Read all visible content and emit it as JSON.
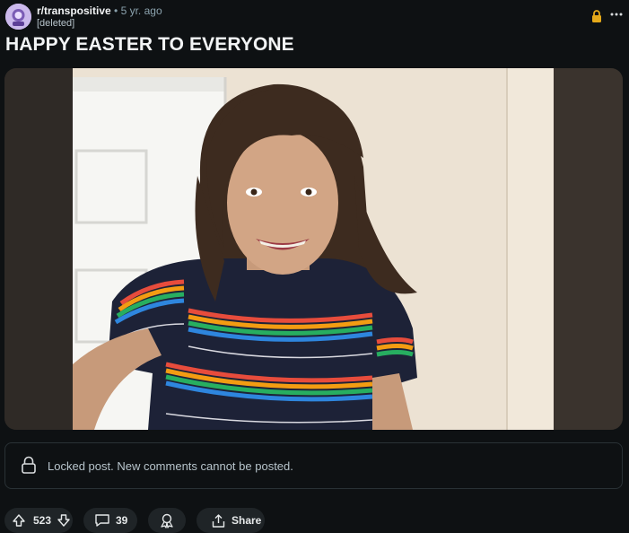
{
  "post": {
    "subreddit": "r/transpositive",
    "separator": "•",
    "age": "5 yr. ago",
    "author": "[deleted]",
    "title": "HAPPY EASTER TO EVERYONE"
  },
  "locked_notice": "Locked post. New comments cannot be posted.",
  "actions": {
    "votes": "523",
    "comments": "39",
    "share_label": "Share"
  },
  "icons": {
    "lock_top": "lock-icon",
    "more": "ellipsis-icon",
    "upvote": "arrow-up-icon",
    "downvote": "arrow-down-icon",
    "comment": "speech-bubble-icon",
    "award": "award-icon",
    "share": "share-icon"
  },
  "colors": {
    "background": "#0e1113",
    "lock_accent": "#e5a91a",
    "pill_bg": "#1f2427"
  }
}
